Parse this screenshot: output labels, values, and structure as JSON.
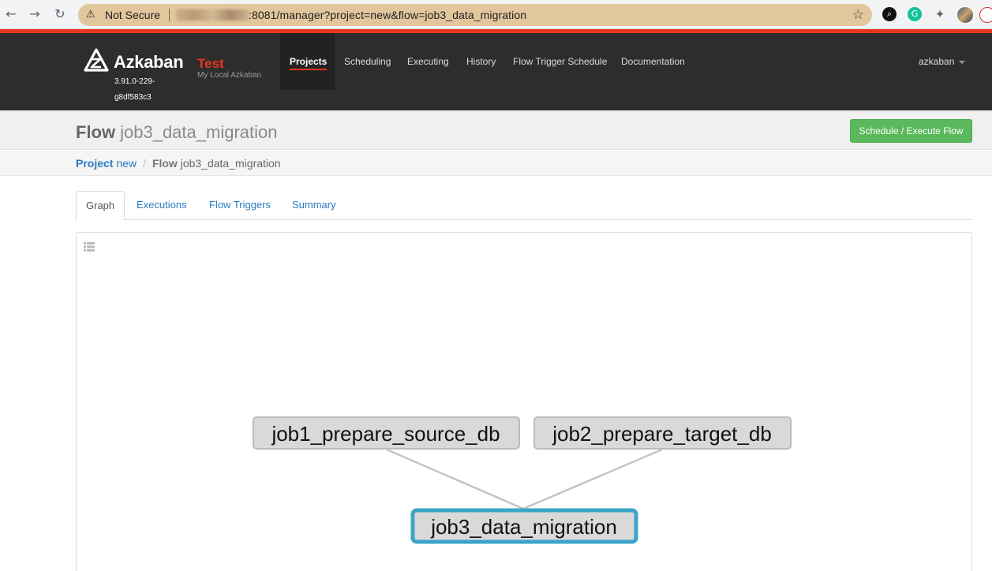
{
  "browser": {
    "back_icon": "arrow-left-icon",
    "forward_icon": "arrow-right-icon",
    "reload_icon": "reload-icon",
    "security_label": "Not Secure",
    "url": ":8081/manager?project=new&flow=job3_data_migration",
    "bookmark_icon": "star-icon"
  },
  "header": {
    "brand": "Azkaban",
    "version": "3.91.0-229-g8df583c3",
    "env_name": "Test",
    "env_subtitle": "My Local Azkaban",
    "nav": [
      {
        "label": "Projects",
        "active": true
      },
      {
        "label": "Scheduling"
      },
      {
        "label": "Executing"
      },
      {
        "label": "History"
      },
      {
        "label": "Flow Trigger Schedule"
      },
      {
        "label": "Documentation"
      }
    ],
    "user": "azkaban",
    "accent": "#e6361f"
  },
  "page": {
    "title_kind": "Flow",
    "title_name": "job3_data_migration",
    "action_button": "Schedule / Execute Flow",
    "breadcrumb": {
      "project_kind": "Project",
      "project_name": "new",
      "flow_kind": "Flow",
      "flow_name": "job3_data_migration"
    }
  },
  "tabs": [
    {
      "label": "Graph",
      "active": true
    },
    {
      "label": "Executions"
    },
    {
      "label": "Flow Triggers"
    },
    {
      "label": "Summary"
    }
  ],
  "graph": {
    "toggle_icon": "list-icon",
    "nodes": [
      {
        "label": "job1_prepare_source_db"
      },
      {
        "label": "job2_prepare_target_db"
      },
      {
        "label": "job3_data_migration",
        "selected": true
      }
    ],
    "edges": [
      {
        "from": "job1_prepare_source_db",
        "to": "job3_data_migration"
      },
      {
        "from": "job2_prepare_target_db",
        "to": "job3_data_migration"
      }
    ],
    "selected_color": "#3aa5c8"
  },
  "colors": {
    "navbar": "#2d2d2d",
    "button_green": "#5cb85c",
    "link_blue": "#2a7bc0"
  }
}
